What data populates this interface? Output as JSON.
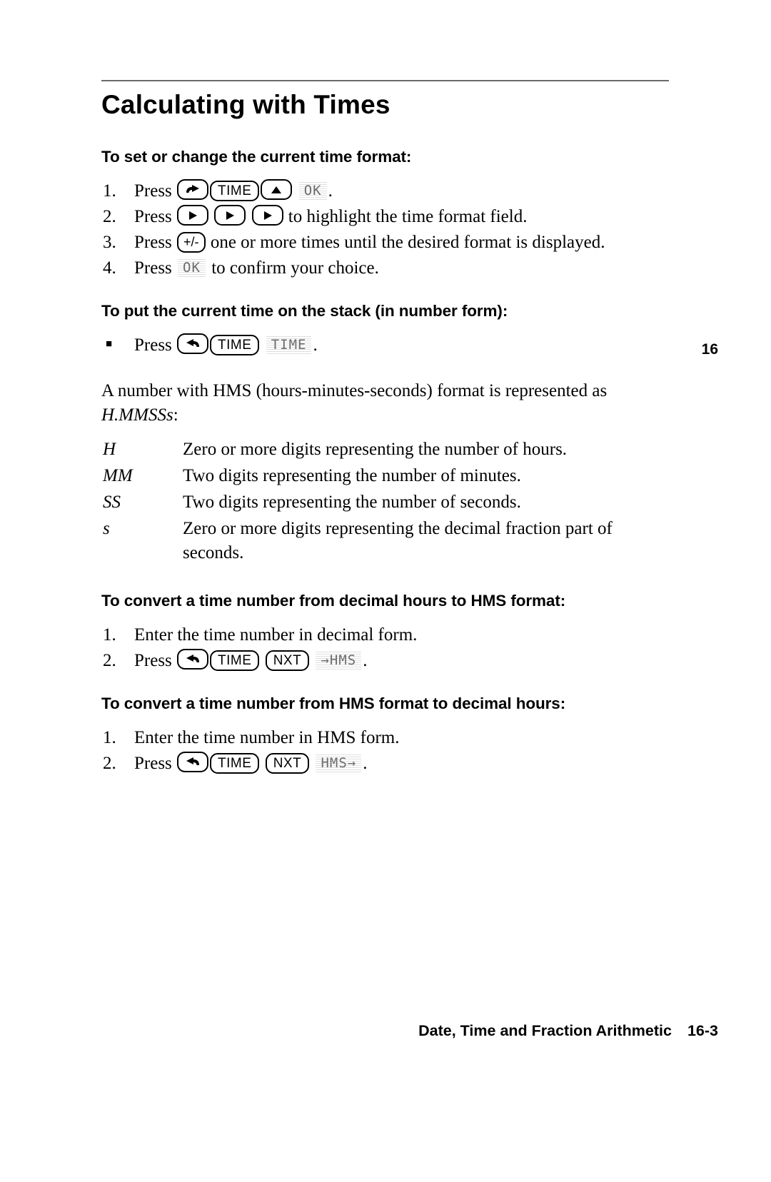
{
  "page": {
    "title": "Calculating with Times",
    "chapter_tab": "16",
    "footer_text": "Date, Time and Fraction Arithmetic",
    "footer_page": "16-3"
  },
  "sections": [
    {
      "heading": "To set or change the current time format:",
      "steps": [
        {
          "marker": "1.",
          "lead": "Press",
          "keys": [
            "right-shift",
            "TIME",
            "up-arrow"
          ],
          "softkey": "OK",
          "trail": "."
        },
        {
          "marker": "2.",
          "lead": "Press",
          "keys": [
            "right-arrow",
            "right-arrow",
            "right-arrow"
          ],
          "trail": "to highlight the time format field."
        },
        {
          "marker": "3.",
          "lead": "Press",
          "keys": [
            "+/-"
          ],
          "trail": "one or more times until the desired format is displayed."
        },
        {
          "marker": "4.",
          "lead": "Press",
          "softkey": "OK",
          "trail": "to confirm your choice."
        }
      ]
    },
    {
      "heading": "To put the current time on the stack (in number form):",
      "steps": [
        {
          "marker": "■",
          "lead": "Press",
          "keys": [
            "left-shift",
            "TIME"
          ],
          "softkey": "TIME",
          "trail": "."
        }
      ]
    }
  ],
  "hms_paragraph": {
    "line1": "A number with HMS (hours-minutes-seconds) format is represented as",
    "line2_italic": "H.MMSSs",
    "line2_tail": ":"
  },
  "definitions": {
    "rows": [
      {
        "term": "H",
        "desc": "Zero or more digits representing the number of hours."
      },
      {
        "term": "MM",
        "desc": "Two digits representing the number of minutes."
      },
      {
        "term": "SS",
        "desc": "Two digits representing the number of seconds."
      },
      {
        "term": "s",
        "desc": "Zero or more digits representing the decimal fraction part of seconds."
      }
    ]
  },
  "convert_to_hms": {
    "heading": "To convert a time number from decimal hours to HMS format:",
    "steps": [
      {
        "marker": "1.",
        "lead": "Enter the time number in decimal form."
      },
      {
        "marker": "2.",
        "lead": "Press",
        "keys": [
          "left-shift",
          "TIME",
          "NXT"
        ],
        "softkey": "→HMS",
        "trail": "."
      }
    ]
  },
  "convert_from_hms": {
    "heading": "To convert a time number from HMS format to decimal hours:",
    "steps": [
      {
        "marker": "1.",
        "lead": "Enter the time number in HMS form."
      },
      {
        "marker": "2.",
        "lead": "Press",
        "keys": [
          "left-shift",
          "TIME",
          "NXT"
        ],
        "softkey": "HMS→",
        "trail": "."
      }
    ]
  },
  "key_labels": {
    "time": "TIME",
    "nxt": "NXT",
    "plus_minus": "+/-"
  }
}
